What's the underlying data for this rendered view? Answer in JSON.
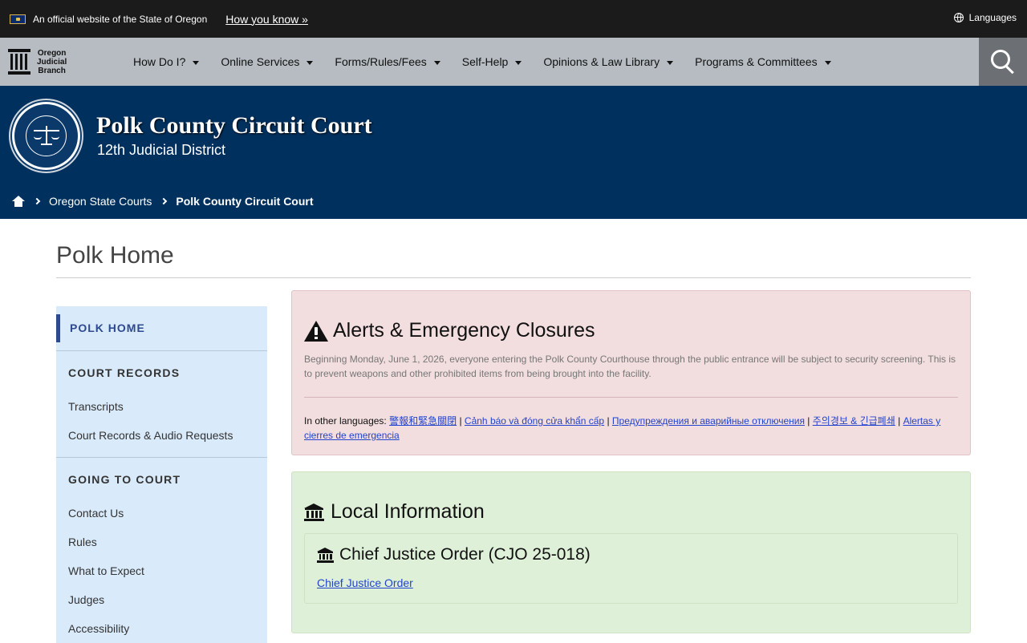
{
  "official_bar": {
    "text": "An official website of the State of Oregon",
    "how_link": "How you know »",
    "languages": "Languages"
  },
  "nav": {
    "brand_lines": [
      "Oregon",
      "Judicial",
      "Branch"
    ],
    "items": [
      {
        "label": "How Do I?"
      },
      {
        "label": "Online Services"
      },
      {
        "label": "Forms/Rules/Fees"
      },
      {
        "label": "Self-Help"
      },
      {
        "label": "Opinions & Law Library"
      },
      {
        "label": "Programs & Committees"
      }
    ]
  },
  "banner": {
    "title": "Polk County Circuit Court",
    "subtitle": "12th Judicial District"
  },
  "breadcrumb": {
    "link": "Oregon State Courts",
    "current": "Polk County Circuit Court"
  },
  "page": {
    "title": "Polk Home"
  },
  "sidebar": {
    "active": "POLK HOME",
    "sections": [
      {
        "heading": "COURT RECORDS",
        "links": [
          "Transcripts",
          "Court Records & Audio Requests"
        ]
      },
      {
        "heading": "GOING TO COURT",
        "links": [
          "Contact Us",
          "Rules",
          "What to Expect",
          "Judges",
          "Accessibility"
        ]
      }
    ]
  },
  "alert": {
    "heading": "Alerts & Emergency Closures",
    "body": "Beginning Monday, June 1, 2026, everyone entering the Polk County Courthouse through the public entrance will be subject to security screening. This is to prevent weapons and other prohibited items from being brought into the facility.",
    "other_label": "In other languages:",
    "languages": [
      "警報和緊急關閉",
      "Cảnh báo và đóng cửa khẩn cấp",
      "Предупреждения и аварийные отключения",
      "주의경보 & 긴급폐쇄",
      "Alertas y cierres de emergencia"
    ],
    "separator": "|"
  },
  "info": {
    "heading": "Local Information",
    "item_title": "Chief Justice Order (CJO 25-018)",
    "item_link": "Chief Justice Order"
  },
  "colors": {
    "topbar": "#1b1b1b",
    "nav": "#b6bcc2",
    "banner": "#00305e",
    "sidebar": "#d9eafa",
    "alert_bg": "#f2dddf",
    "info_bg": "#dff0d8",
    "link": "#2244cc"
  }
}
